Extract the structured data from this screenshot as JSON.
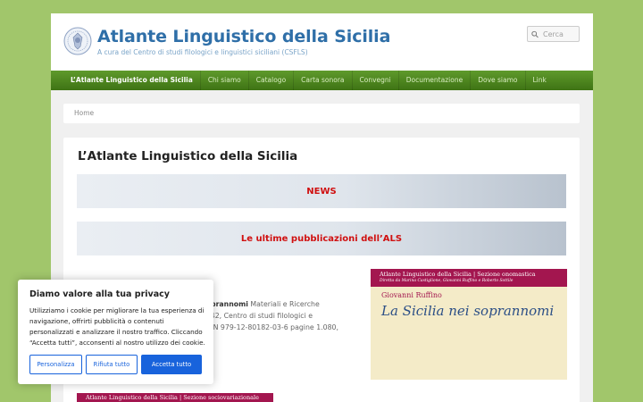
{
  "header": {
    "title": "Atlante Linguistico della Sicilia",
    "description": "A cura del Centro di studi filologici e linguistici siciliani (CSFLS)",
    "logo_icon": "crest-icon",
    "search": {
      "placeholder": "Cerca",
      "icon": "search-icon"
    }
  },
  "nav": {
    "items": [
      {
        "label": "L’Atlante Linguistico della Sicilia",
        "active": true
      },
      {
        "label": "Chi siamo"
      },
      {
        "label": "Catalogo"
      },
      {
        "label": "Carta sonora"
      },
      {
        "label": "Convegni"
      },
      {
        "label": "Documentazione"
      },
      {
        "label": "Dove siamo"
      },
      {
        "label": "Link"
      }
    ]
  },
  "breadcrumb": {
    "home": "Home"
  },
  "main": {
    "title": "L’Atlante Linguistico della Sicilia",
    "news_banner": "NEWS",
    "pubs_banner": "Le ultime pubblicazioni dell’ALS",
    "pub1": {
      "title_fragment": "soprannomi",
      "text_line1": " Materiali e Ricerche",
      "text_line2": "a, 42, Centro di studi filologici e",
      "text_line3": "ISBN 979-12-80182-03-6 pagine 1.080,"
    },
    "book1": {
      "series": "Atlante Linguistico della Sicilia | Sezione onomastica",
      "editors": "Diretta da Marina Castiglione, Giovanni Ruffino e Roberto Sottile",
      "author": "Giovanni Ruffino",
      "title": "La Sicilia nei soprannomi"
    },
    "book2": {
      "series": "Atlante Linguistico della Sicilia | Sezione sociovariazionale"
    }
  },
  "cookie": {
    "title": "Diamo valore alla tua privacy",
    "text": "Utilizziamo i cookie per migliorare la tua esperienza di navigazione, offrirti pubblicità o contenuti personalizzati e analizzare il nostro traffico. Cliccando “Accetta tutti”, acconsenti al nostro utilizzo dei cookie.",
    "customize_label": "Personalizza",
    "reject_label": "Rifiuta tutto",
    "accept_label": "Accetta tutto",
    "accent_color": "#1863dc"
  },
  "colors": {
    "background": "#a1c66b",
    "nav": "#4f8a22",
    "title": "#2f6fa8",
    "banner_text": "#d01010"
  }
}
